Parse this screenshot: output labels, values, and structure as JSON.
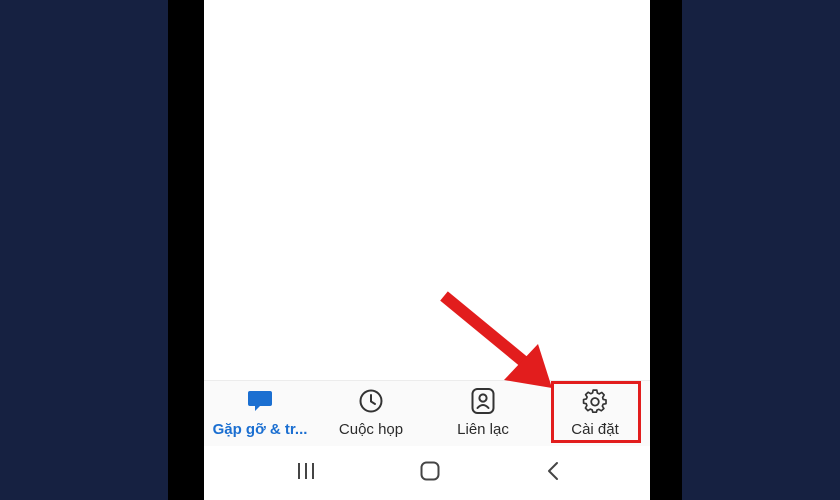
{
  "tabbar": {
    "tabs": [
      {
        "label": "Gặp gỡ & tr...",
        "icon": "chat-bubble-icon",
        "active": true
      },
      {
        "label": "Cuộc họp",
        "icon": "clock-icon",
        "active": false
      },
      {
        "label": "Liên lạc",
        "icon": "contact-icon",
        "active": false
      },
      {
        "label": "Cài đặt",
        "icon": "gear-icon",
        "active": false
      }
    ]
  },
  "navbar": {
    "buttons": [
      {
        "icon": "recent-apps-icon"
      },
      {
        "icon": "home-icon"
      },
      {
        "icon": "back-icon"
      }
    ]
  },
  "annotation": {
    "arrow_color": "#e21d1d",
    "highlight_color": "#e21d1d",
    "accent_color": "#1b6fd1"
  }
}
